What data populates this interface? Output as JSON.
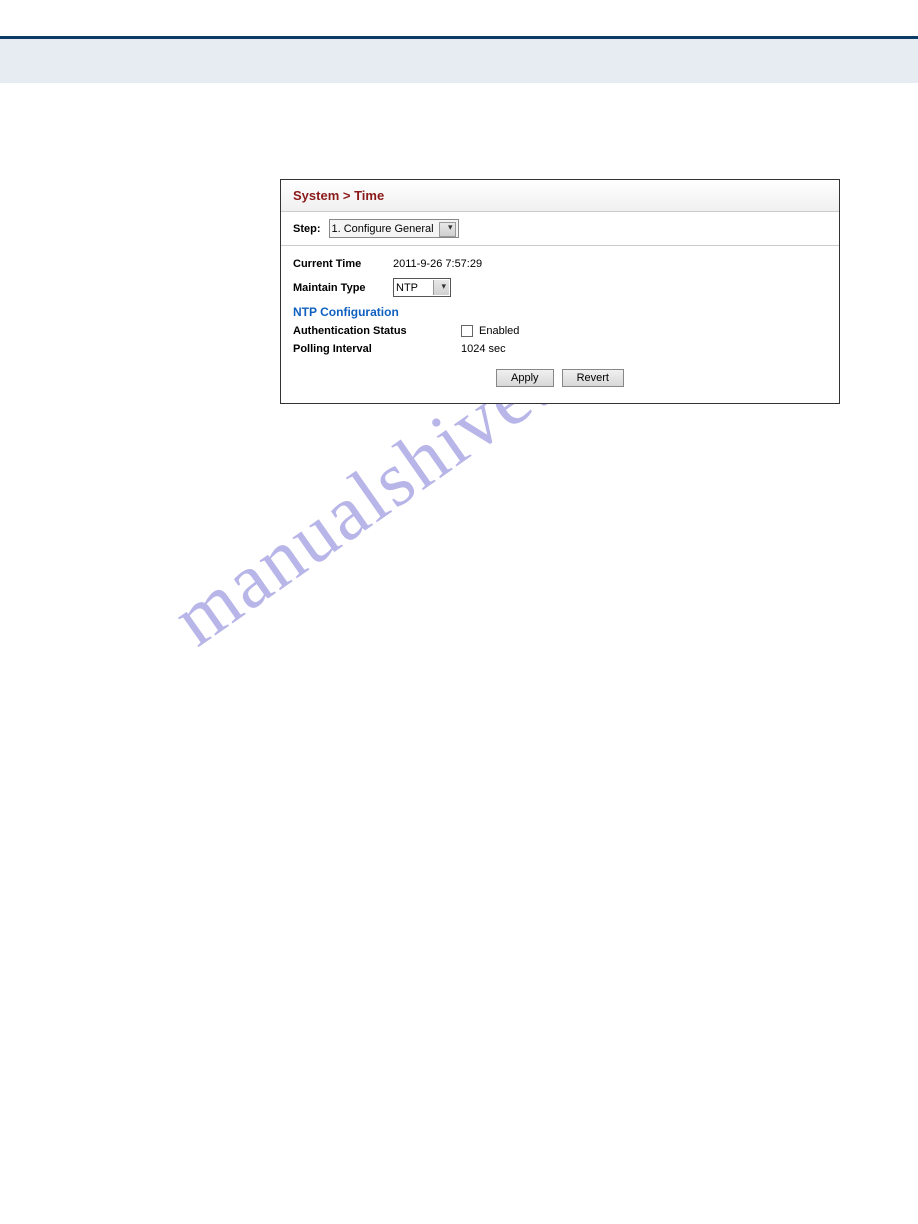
{
  "watermark": "manualshive.com",
  "panel": {
    "title": "System > Time",
    "step": {
      "label": "Step:",
      "value": "1. Configure General"
    },
    "rows": {
      "current_time": {
        "label": "Current Time",
        "value": "2011-9-26 7:57:29"
      },
      "maintain_type": {
        "label": "Maintain Type",
        "value": "NTP"
      }
    },
    "section": {
      "header": "NTP Configuration",
      "auth_status": {
        "label": "Authentication Status",
        "checkbox_label": "Enabled"
      },
      "polling_interval": {
        "label": "Polling Interval",
        "value": "1024 sec"
      }
    },
    "buttons": {
      "apply": "Apply",
      "revert": "Revert"
    }
  }
}
